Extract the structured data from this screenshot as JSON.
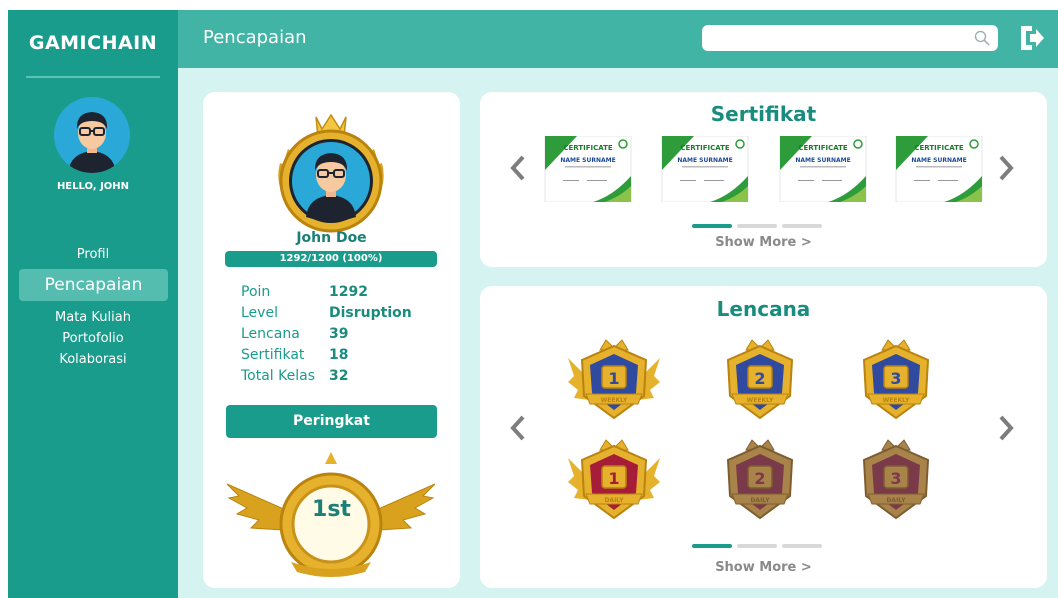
{
  "app": {
    "brand": "GAMICHAIN"
  },
  "sidebar": {
    "greeting": "HELLO, JOHN",
    "items": [
      {
        "label": "Profil",
        "active": false
      },
      {
        "label": "Pencapaian",
        "active": true
      },
      {
        "label": "Mata Kuliah",
        "active": false
      },
      {
        "label": "Portofolio",
        "active": false
      },
      {
        "label": "Kolaborasi",
        "active": false
      }
    ]
  },
  "header": {
    "title": "Pencapaian",
    "search": {
      "value": "",
      "placeholder": ""
    }
  },
  "profile": {
    "name": "John Doe",
    "progress_text": "1292/1200 (100%)",
    "progress_fraction": 1.0,
    "stats": [
      {
        "label": "Poin",
        "value": "1292"
      },
      {
        "label": "Level",
        "value": "Disruption"
      },
      {
        "label": "Lencana",
        "value": "39"
      },
      {
        "label": "Sertifikat",
        "value": "18"
      },
      {
        "label": "Total Kelas",
        "value": "32"
      }
    ],
    "rank_button": "Peringkat",
    "rank": "1st"
  },
  "certificates": {
    "title": "Sertifikat",
    "show_more": "Show More >",
    "page": 1,
    "pages": 3,
    "items": [
      {
        "heading": "CERTIFICATE",
        "name": "NAME SURNAME"
      },
      {
        "heading": "CERTIFICATE",
        "name": "NAME SURNAME"
      },
      {
        "heading": "CERTIFICATE",
        "name": "NAME SURNAME"
      },
      {
        "heading": "CERTIFICATE",
        "name": "NAME SURNAME"
      }
    ]
  },
  "badges": {
    "title": "Lencana",
    "show_more": "Show More >",
    "page": 1,
    "pages": 3,
    "items": [
      {
        "number": "1",
        "banner": "WEEKLY",
        "color": "#2f4a9e",
        "earned": true
      },
      {
        "number": "2",
        "banner": "WEEKLY",
        "color": "#2f4a9e",
        "earned": true
      },
      {
        "number": "3",
        "banner": "WEEKLY",
        "color": "#2f4a9e",
        "earned": true
      },
      {
        "number": "1",
        "banner": "DAILY",
        "color": "#a61d3a",
        "earned": true
      },
      {
        "number": "2",
        "banner": "DAILY",
        "color": "#7a3a4a",
        "earned": false
      },
      {
        "number": "3",
        "banner": "DAILY",
        "color": "#7a3a4a",
        "earned": false
      }
    ]
  },
  "colors": {
    "primary": "#1a9c8c",
    "header": "#41b4a6",
    "background": "#d5f3f0",
    "gold": "#e8b22f"
  },
  "icons": {
    "search": "search-icon",
    "logout": "logout-icon",
    "prev": "chevron-left-icon",
    "next": "chevron-right-icon"
  }
}
